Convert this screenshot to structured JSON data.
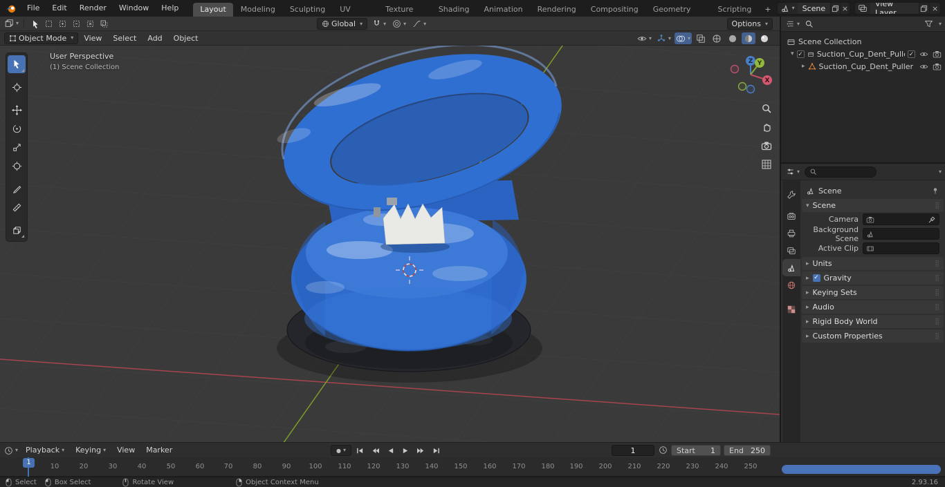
{
  "icons": {
    "chevron_down": "▾",
    "tri_right": "▸",
    "tri_down": "▾",
    "drag_handle": "⣿",
    "check": "✓",
    "close": "×",
    "plus": "+",
    "record_dot": "●"
  },
  "topbar": {
    "menus": [
      "File",
      "Edit",
      "Render",
      "Window",
      "Help"
    ],
    "workspaces": [
      "Layout",
      "Modeling",
      "Sculpting",
      "UV Editing",
      "Texture Paint",
      "Shading",
      "Animation",
      "Rendering",
      "Compositing",
      "Geometry Nodes",
      "Scripting"
    ],
    "scene_label": "Scene",
    "view_layer_label": "View Layer"
  },
  "tool_header": {
    "orientation_label": "Global",
    "options_label": "Options"
  },
  "view_header": {
    "mode_label": "Object Mode",
    "menus": [
      "View",
      "Select",
      "Add",
      "Object"
    ]
  },
  "viewport": {
    "overlay_title": "User Perspective",
    "overlay_subtitle": "(1) Scene Collection",
    "gizmo_x": "X",
    "gizmo_y": "Y",
    "gizmo_z": "Z"
  },
  "outliner": {
    "root_label": "Scene Collection",
    "collection_label": "Suction_Cup_Dent_Puller_Fak",
    "object_label": "Suction_Cup_Dent_Puller"
  },
  "properties": {
    "breadcrumb_label": "Scene",
    "scene_panel": "Scene",
    "camera_label": "Camera",
    "background_label": "Background Scene",
    "clip_label": "Active Clip",
    "units_panel": "Units",
    "gravity_panel": "Gravity",
    "keying_panel": "Keying Sets",
    "audio_panel": "Audio",
    "rigid_panel": "Rigid Body World",
    "custom_panel": "Custom Properties"
  },
  "timeline": {
    "playback_label": "Playback",
    "keying_label": "Keying",
    "view_label": "View",
    "marker_label": "Marker",
    "frame_value": "1",
    "start_label": "Start",
    "start_value": "1",
    "end_label": "End",
    "end_value": "250",
    "playhead_label": "1",
    "ruler": [
      "10",
      "20",
      "30",
      "40",
      "50",
      "60",
      "70",
      "80",
      "90",
      "100",
      "110",
      "120",
      "130",
      "140",
      "150",
      "160",
      "170",
      "180",
      "190",
      "200",
      "210",
      "220",
      "230",
      "240",
      "250"
    ]
  },
  "statusbar": {
    "items": [
      "Select",
      "Box Select",
      "Rotate View",
      "Object Context Menu"
    ],
    "version": "2.93.16"
  },
  "colors": {
    "accent": "#4772b3",
    "axis_x": "#a8444e",
    "axis_y": "#7d9c28",
    "object_blue": "#2e6bcd",
    "selection_orange": "#e0883c"
  }
}
